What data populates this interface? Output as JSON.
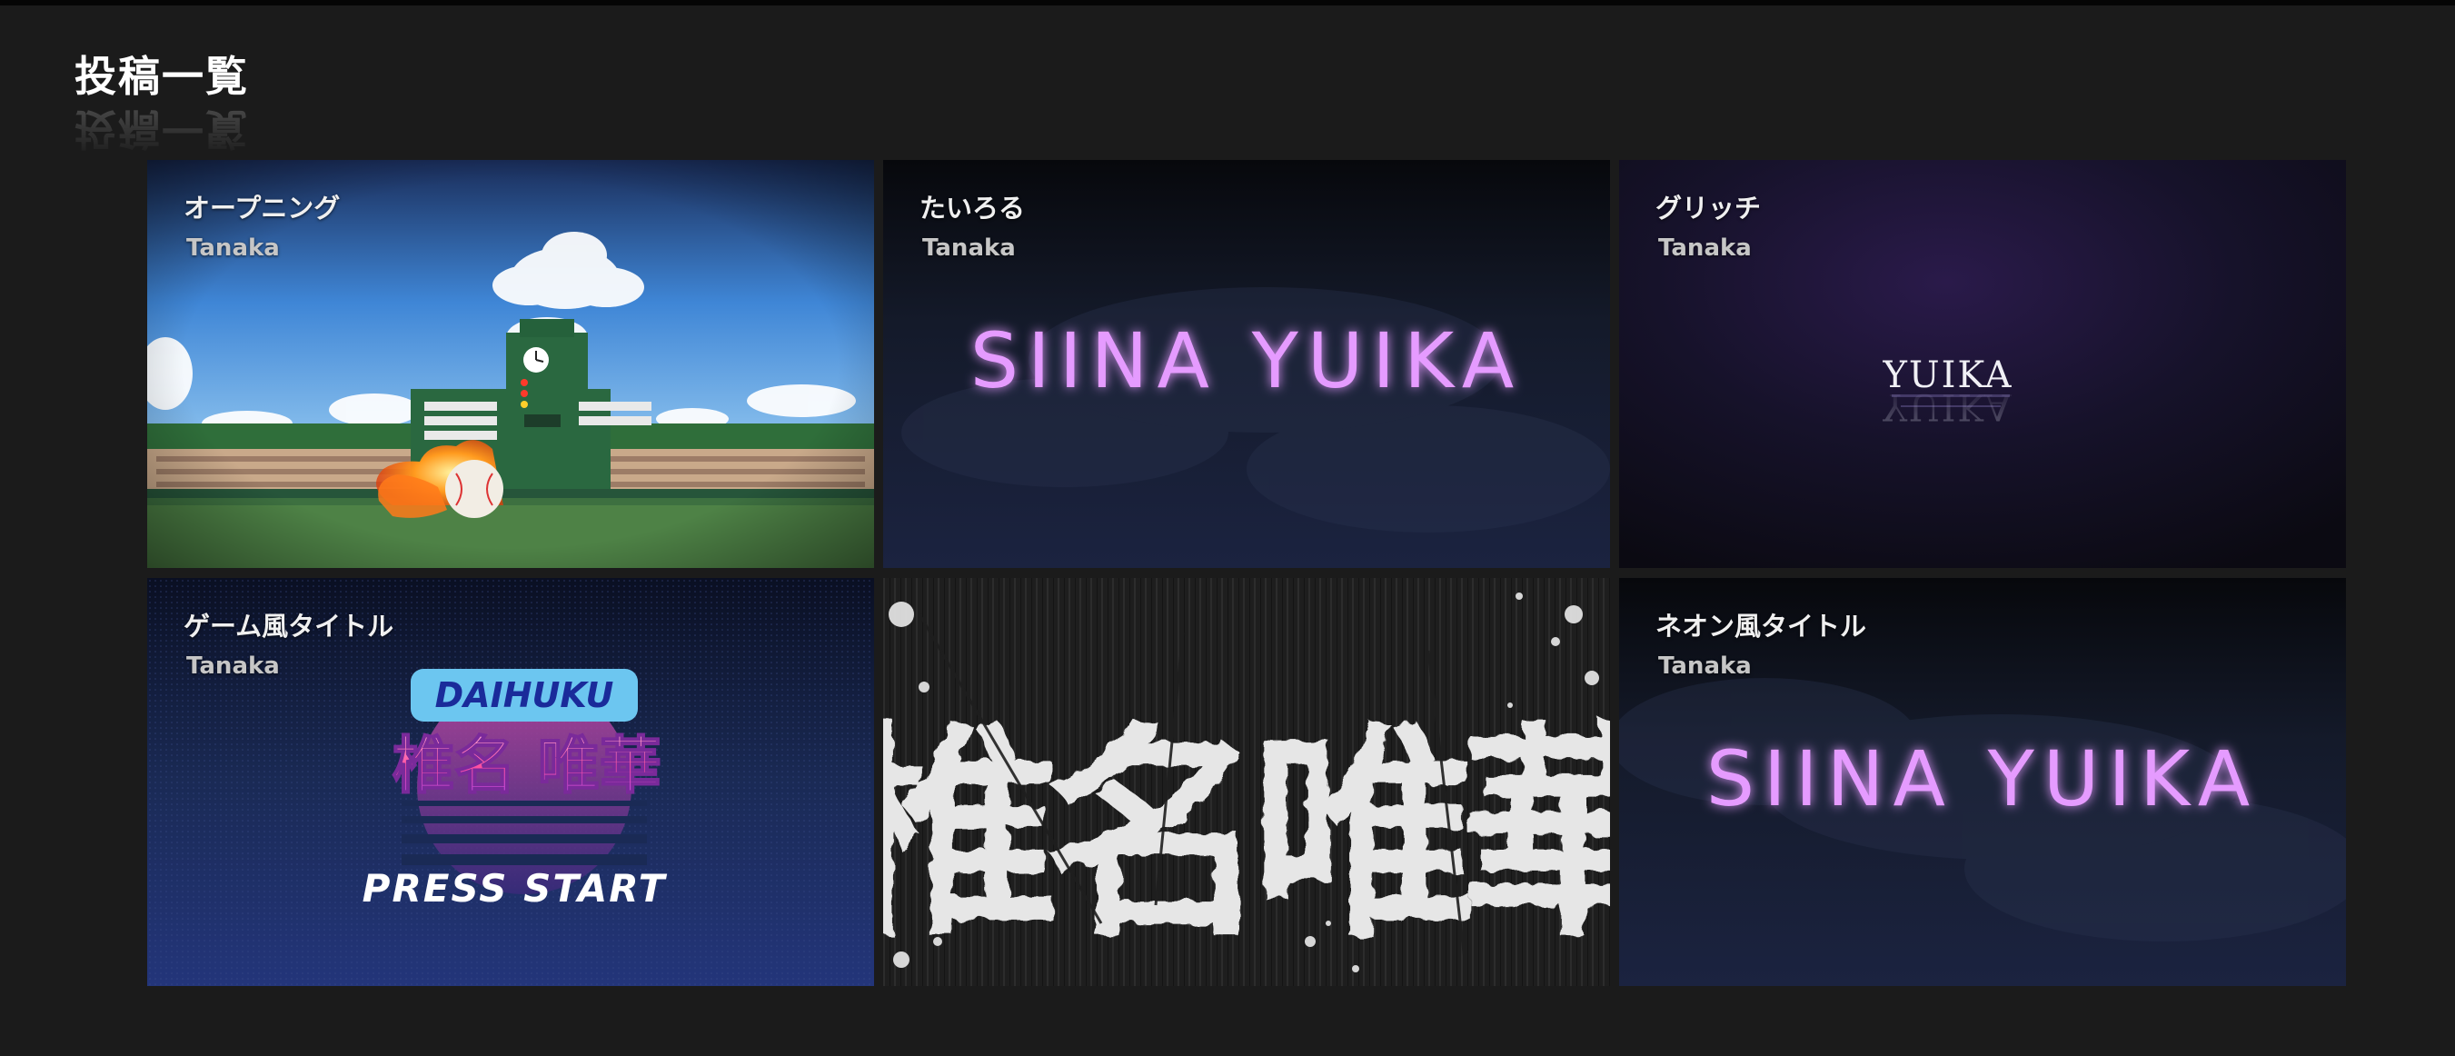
{
  "page": {
    "title": "投稿一覧"
  },
  "posts": [
    {
      "title": "オープニング",
      "author": "Tanaka"
    },
    {
      "title": "たいろる",
      "author": "Tanaka",
      "thumb_text": "SIINA YUIKA"
    },
    {
      "title": "グリッチ",
      "author": "Tanaka",
      "thumb_text": "YUIKA"
    },
    {
      "title": "ゲーム風タイトル",
      "author": "Tanaka",
      "thumb_logo": "DAIHUKU",
      "thumb_name": "椎名 唯華",
      "thumb_prompt": "PRESS START"
    },
    {
      "thumb_text": "椎名唯華"
    },
    {
      "title": "ネオン風タイトル",
      "author": "Tanaka",
      "thumb_text": "SIINA YUIKA"
    }
  ],
  "colors": {
    "background": "#1b1b1b",
    "neon": "#e59bff",
    "title": "#ffffff"
  }
}
